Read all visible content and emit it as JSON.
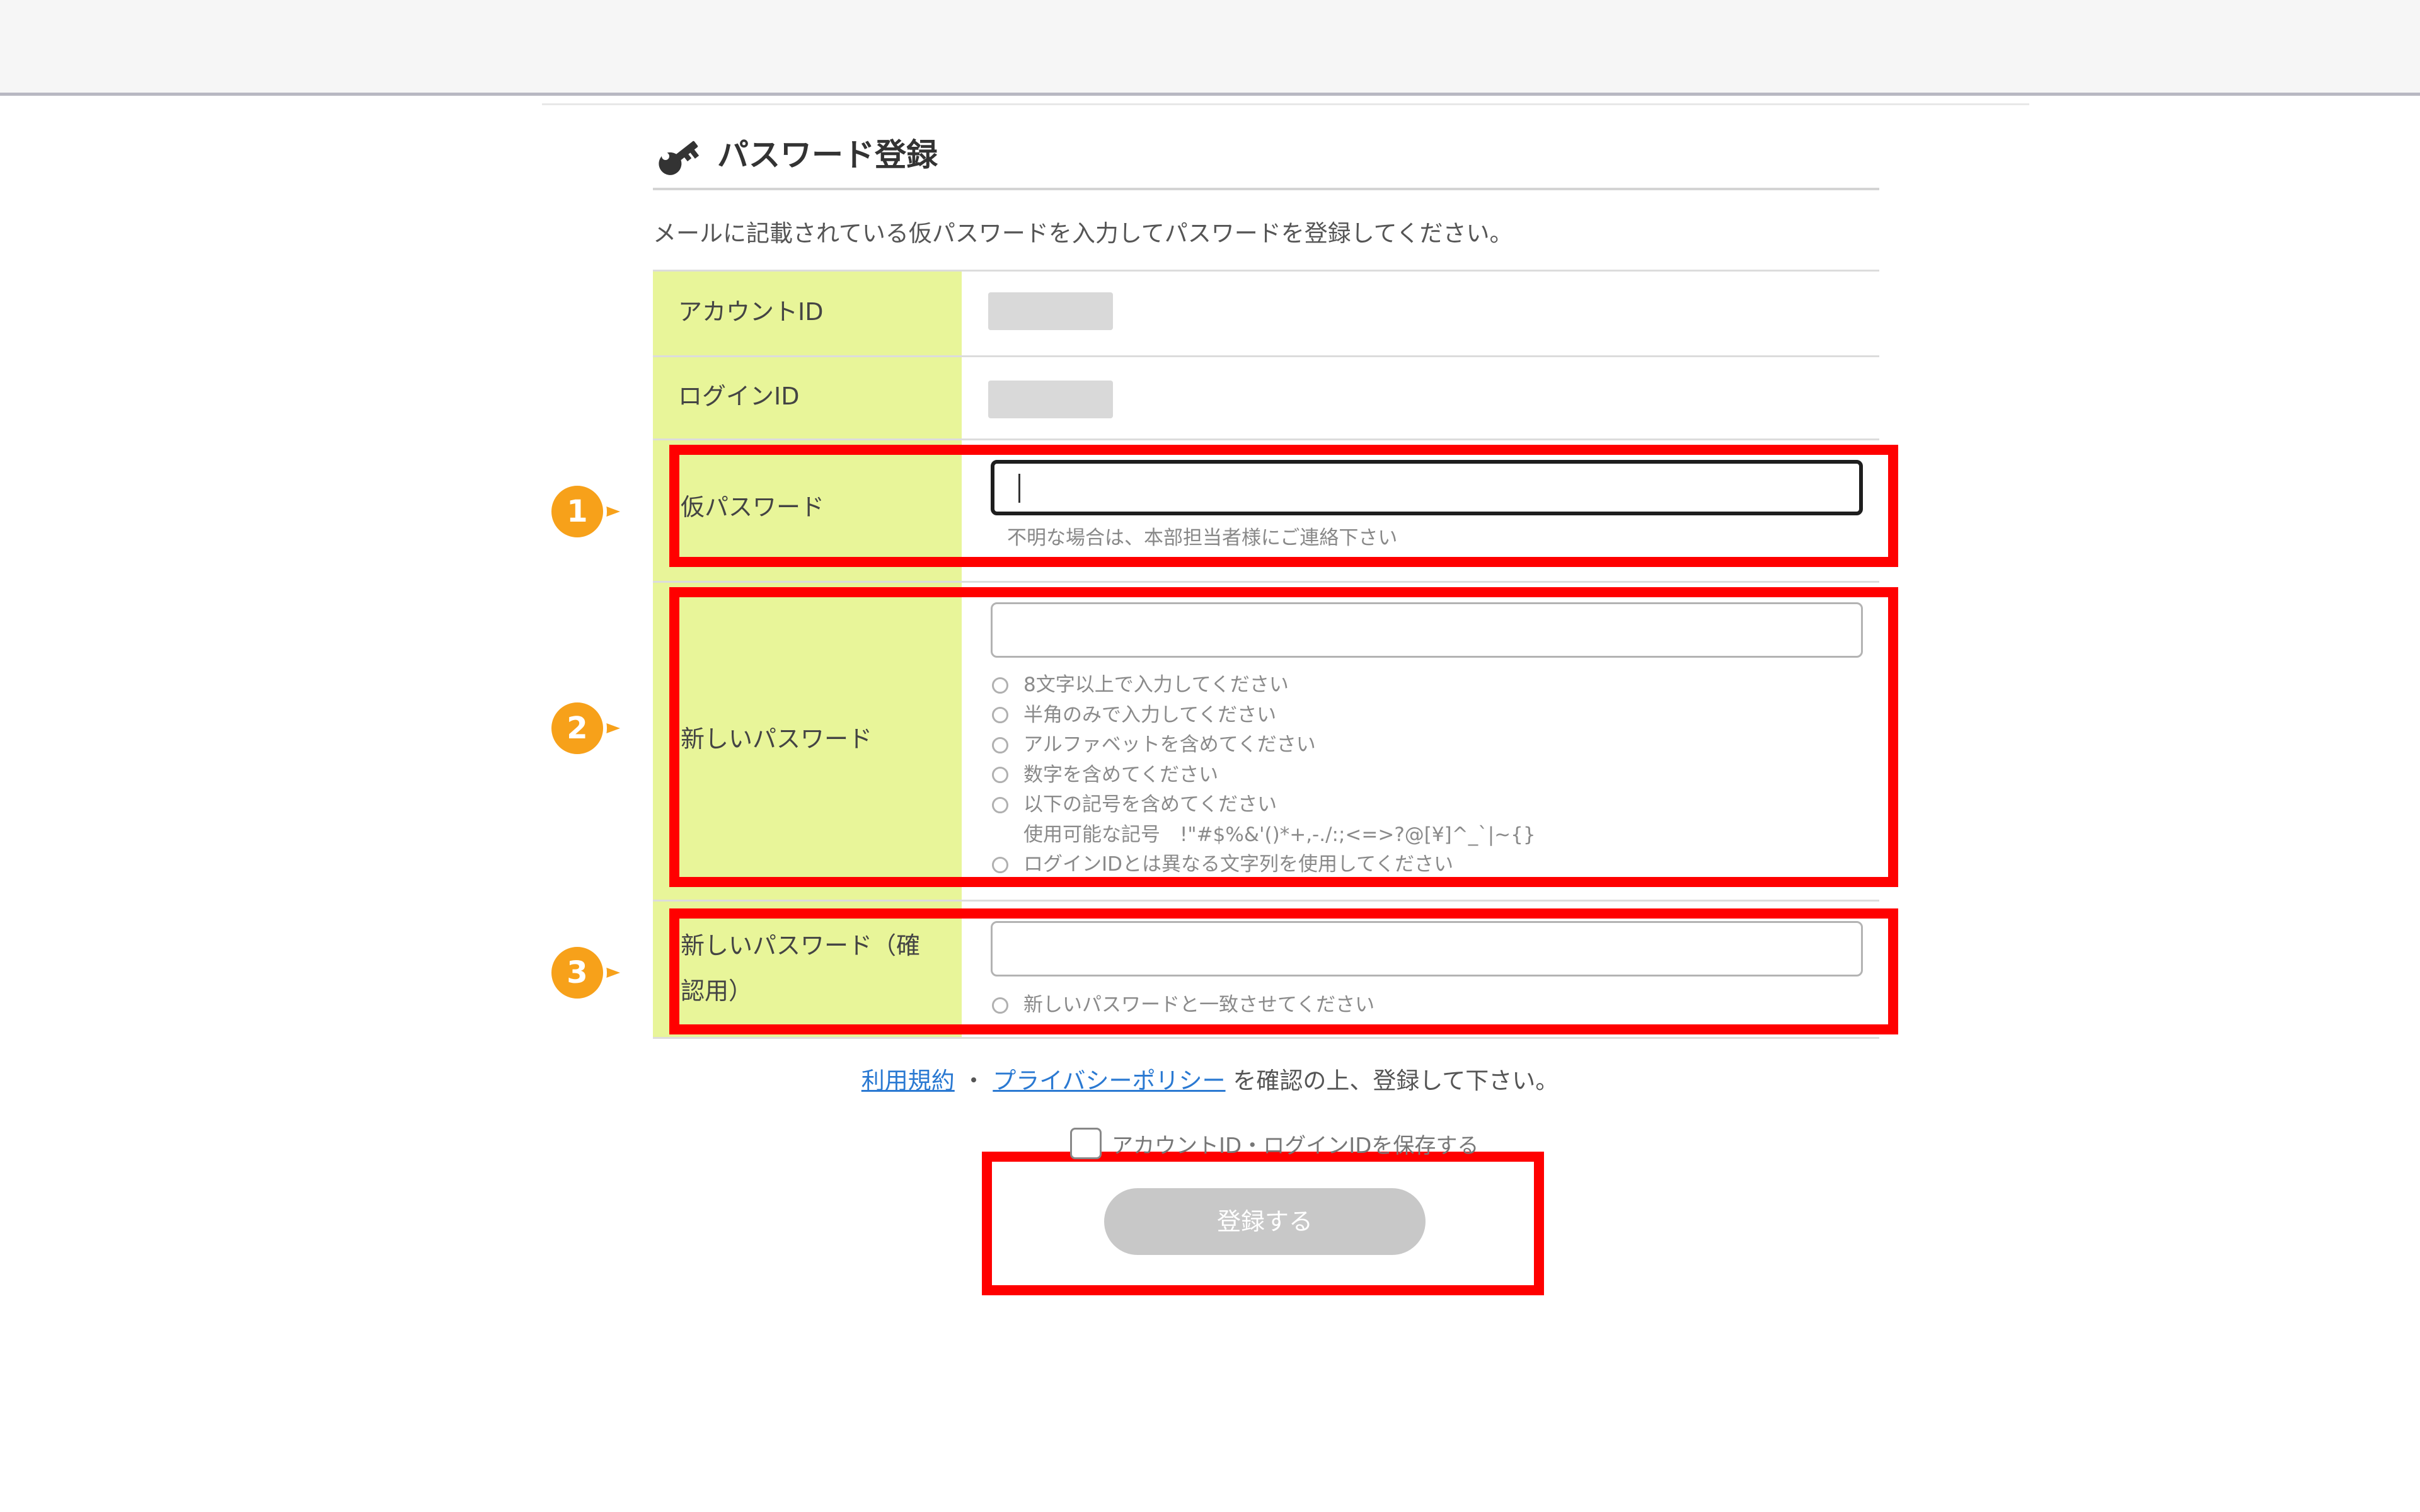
{
  "page": {
    "title": "パスワード登録",
    "intro": "メールに記載されている仮パスワードを入力してパスワードを登録してください。",
    "title_icon": "key-icon"
  },
  "form": {
    "account_id": {
      "label": "アカウントID",
      "value": ""
    },
    "login_id": {
      "label": "ログインID",
      "value": ""
    },
    "temp_password": {
      "label": "仮パスワード",
      "value": "",
      "hint": "不明な場合は、本部担当者様にご連絡下さい"
    },
    "new_password": {
      "label": "新しいパスワード",
      "value": "",
      "rules": [
        "8文字以上で入力してください",
        "半角のみで入力してください",
        "アルファベットを含めてください",
        "数字を含めてください",
        "以下の記号を含めてください",
        "ログインIDとは異なる文字列を使用してください"
      ],
      "symbols_note": "使用可能な記号　!\"#$%&'()*+,-./:;<=>?@[¥]^_`|~{}"
    },
    "confirm_password": {
      "label_line1": "新しいパスワード（確",
      "label_line2": "認用）",
      "value": "",
      "rule": "新しいパスワードと一致させてください"
    }
  },
  "terms": {
    "terms_link": "利用規約",
    "separator": "・",
    "privacy_link": "プライバシーポリシー",
    "suffix": "を確認の上、登録して下さい。"
  },
  "remember": {
    "label": "アカウントID・ログインIDを保存する",
    "checked": false
  },
  "submit": {
    "label": "登録する",
    "enabled": false
  },
  "annotations": {
    "badges": [
      "1",
      "2",
      "3"
    ],
    "highlight_color": "#ff0000",
    "badge_color": "#f7a11a"
  }
}
